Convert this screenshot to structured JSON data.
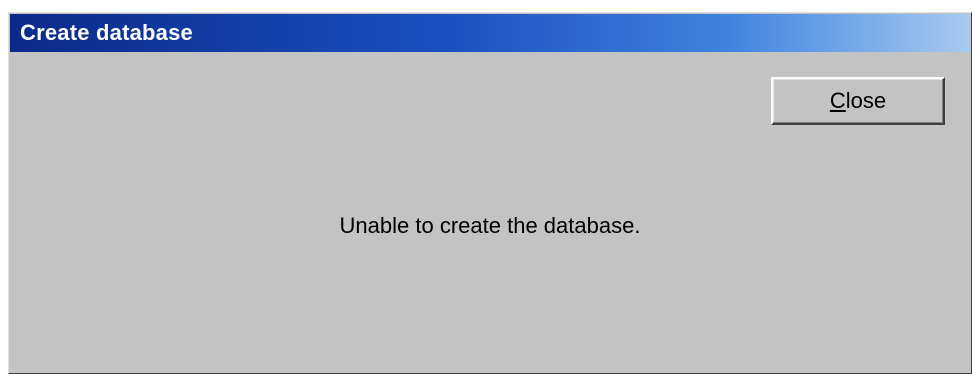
{
  "window": {
    "title": "Create database"
  },
  "close_button": {
    "mnemonic": "C",
    "rest": "lose"
  },
  "message": "Unable to create the database.",
  "colors": {
    "title_gradient_start": "#0a2a8a",
    "title_gradient_end": "#a6caf0",
    "face": "#c3c3c3"
  }
}
